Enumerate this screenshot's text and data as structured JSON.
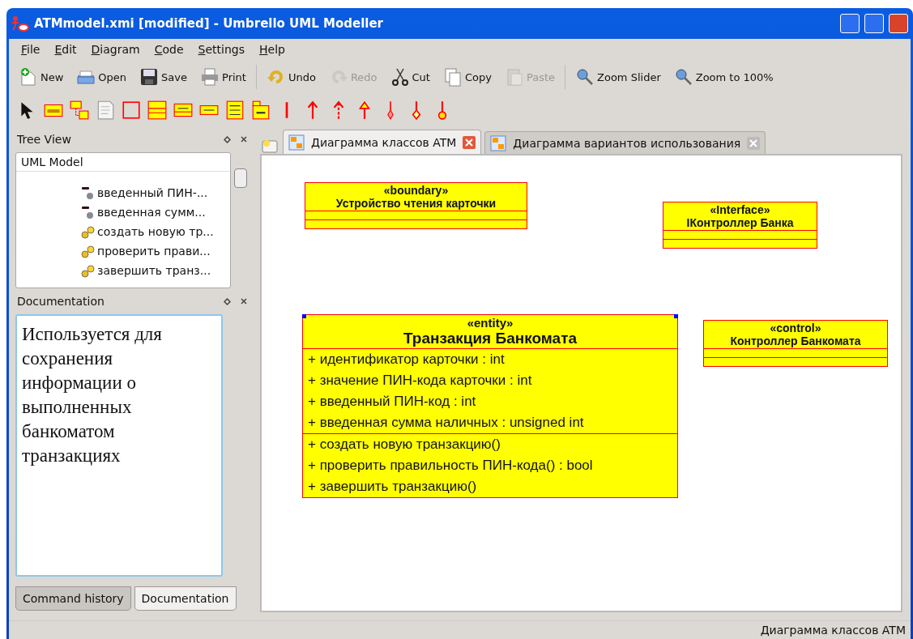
{
  "window": {
    "title": "ATMmodel.xmi [modified] - Umbrello UML Modeller"
  },
  "menu": [
    "File",
    "Edit",
    "Diagram",
    "Code",
    "Settings",
    "Help"
  ],
  "toolbar": [
    {
      "label": "New",
      "disabled": false
    },
    {
      "label": "Open",
      "disabled": false
    },
    {
      "label": "Save",
      "disabled": false
    },
    {
      "label": "Print",
      "disabled": false
    },
    {
      "label": "Undo",
      "disabled": false
    },
    {
      "label": "Redo",
      "disabled": true
    },
    {
      "label": "Cut",
      "disabled": false
    },
    {
      "label": "Copy",
      "disabled": false
    },
    {
      "label": "Paste",
      "disabled": true
    },
    {
      "label": "Zoom Slider",
      "disabled": false
    },
    {
      "label": "Zoom to 100%",
      "disabled": false
    }
  ],
  "tree_view": {
    "title": "Tree View",
    "header": "UML Model",
    "items": [
      {
        "label": "введенный ПИН-...",
        "kind": "attribute"
      },
      {
        "label": "введенная сумм...",
        "kind": "attribute"
      },
      {
        "label": "создать новую тр...",
        "kind": "operation"
      },
      {
        "label": "проверить прави...",
        "kind": "operation"
      },
      {
        "label": "завершить транз...",
        "kind": "operation"
      }
    ]
  },
  "documentation": {
    "title": "Documentation",
    "text": "Используется для сохранения информации о выполненных банкоматом транзакциях"
  },
  "bottom_tabs": [
    {
      "label": "Command history",
      "selected": false
    },
    {
      "label": "Documentation",
      "selected": true
    }
  ],
  "diagram_tabs": [
    {
      "label": "Диаграмма классов ATM",
      "selected": true
    },
    {
      "label": "Диаграмма вариантов использования",
      "selected": false
    }
  ],
  "classes": [
    {
      "stereotype": "«boundary»",
      "name": "Устройство чтения карточки",
      "selected": false
    },
    {
      "stereotype": "«Interface»",
      "name": "IКонтроллер Банка",
      "selected": false
    },
    {
      "stereotype": "«entity»",
      "name": "Транзакция Банкомата",
      "selected": true,
      "attributes": [
        "+ идентификатор карточки : int",
        "+ значение ПИН-кода карточки : int",
        "+ введенный ПИН-код : int",
        "+ введенная сумма наличных : unsigned int"
      ],
      "operations": [
        "+ создать новую транзакцию()",
        "+ проверить правильность ПИН-кода() : bool",
        "+ завершить транзакцию()"
      ]
    },
    {
      "stereotype": "«control»",
      "name": "Контроллер Банкомата",
      "selected": false
    }
  ],
  "status_bar": "Диаграмма классов ATM"
}
